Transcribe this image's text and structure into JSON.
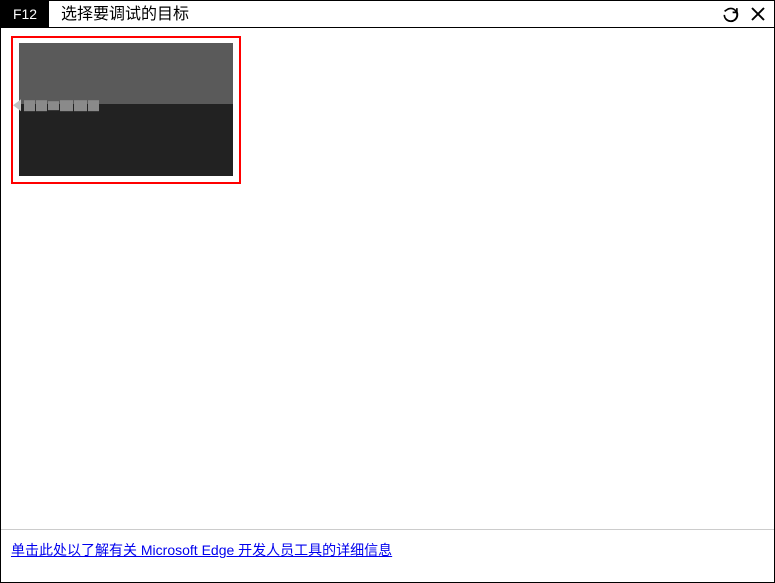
{
  "header": {
    "badge": "F12",
    "title": "选择要调试的目标"
  },
  "footer": {
    "link_text": "单击此处以了解有关 Microsoft Edge 开发人员工具的详细信息"
  }
}
